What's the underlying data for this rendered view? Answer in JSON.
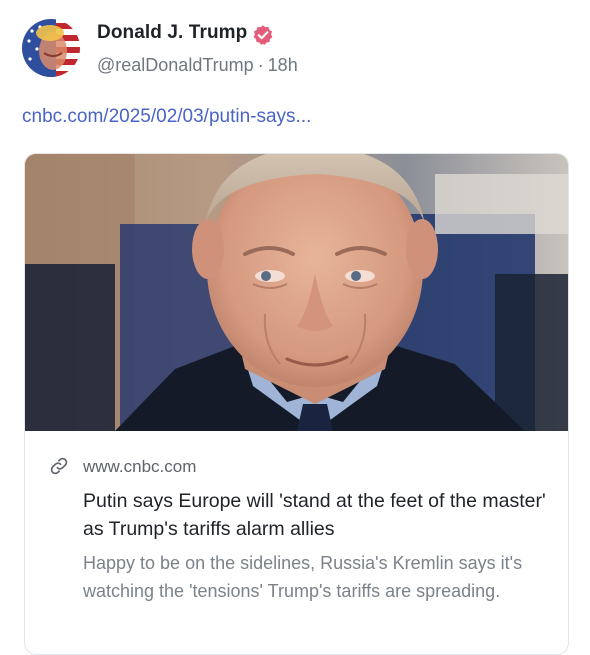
{
  "post": {
    "display_name": "Donald J. Trump",
    "handle": "@realDonaldTrump",
    "separator": "·",
    "time": "18h",
    "link_text": "cnbc.com/2025/02/03/putin-says...",
    "verified_icon": "verified-badge-icon",
    "verified_color": "#e35d7a"
  },
  "card": {
    "domain": "www.cnbc.com",
    "link_icon": "link-icon",
    "title": "Putin says Europe will 'stand at the feet of the master' as Trump's tariffs alarm allies",
    "description": "Happy to be on the sidelines, Russia's Kremlin says it's watching the 'tensions' Trump's tariffs are spreading."
  },
  "colors": {
    "name": "#1f2328",
    "muted": "#6f7781",
    "link": "#4a63c8",
    "card_border": "#e3e6ea"
  }
}
